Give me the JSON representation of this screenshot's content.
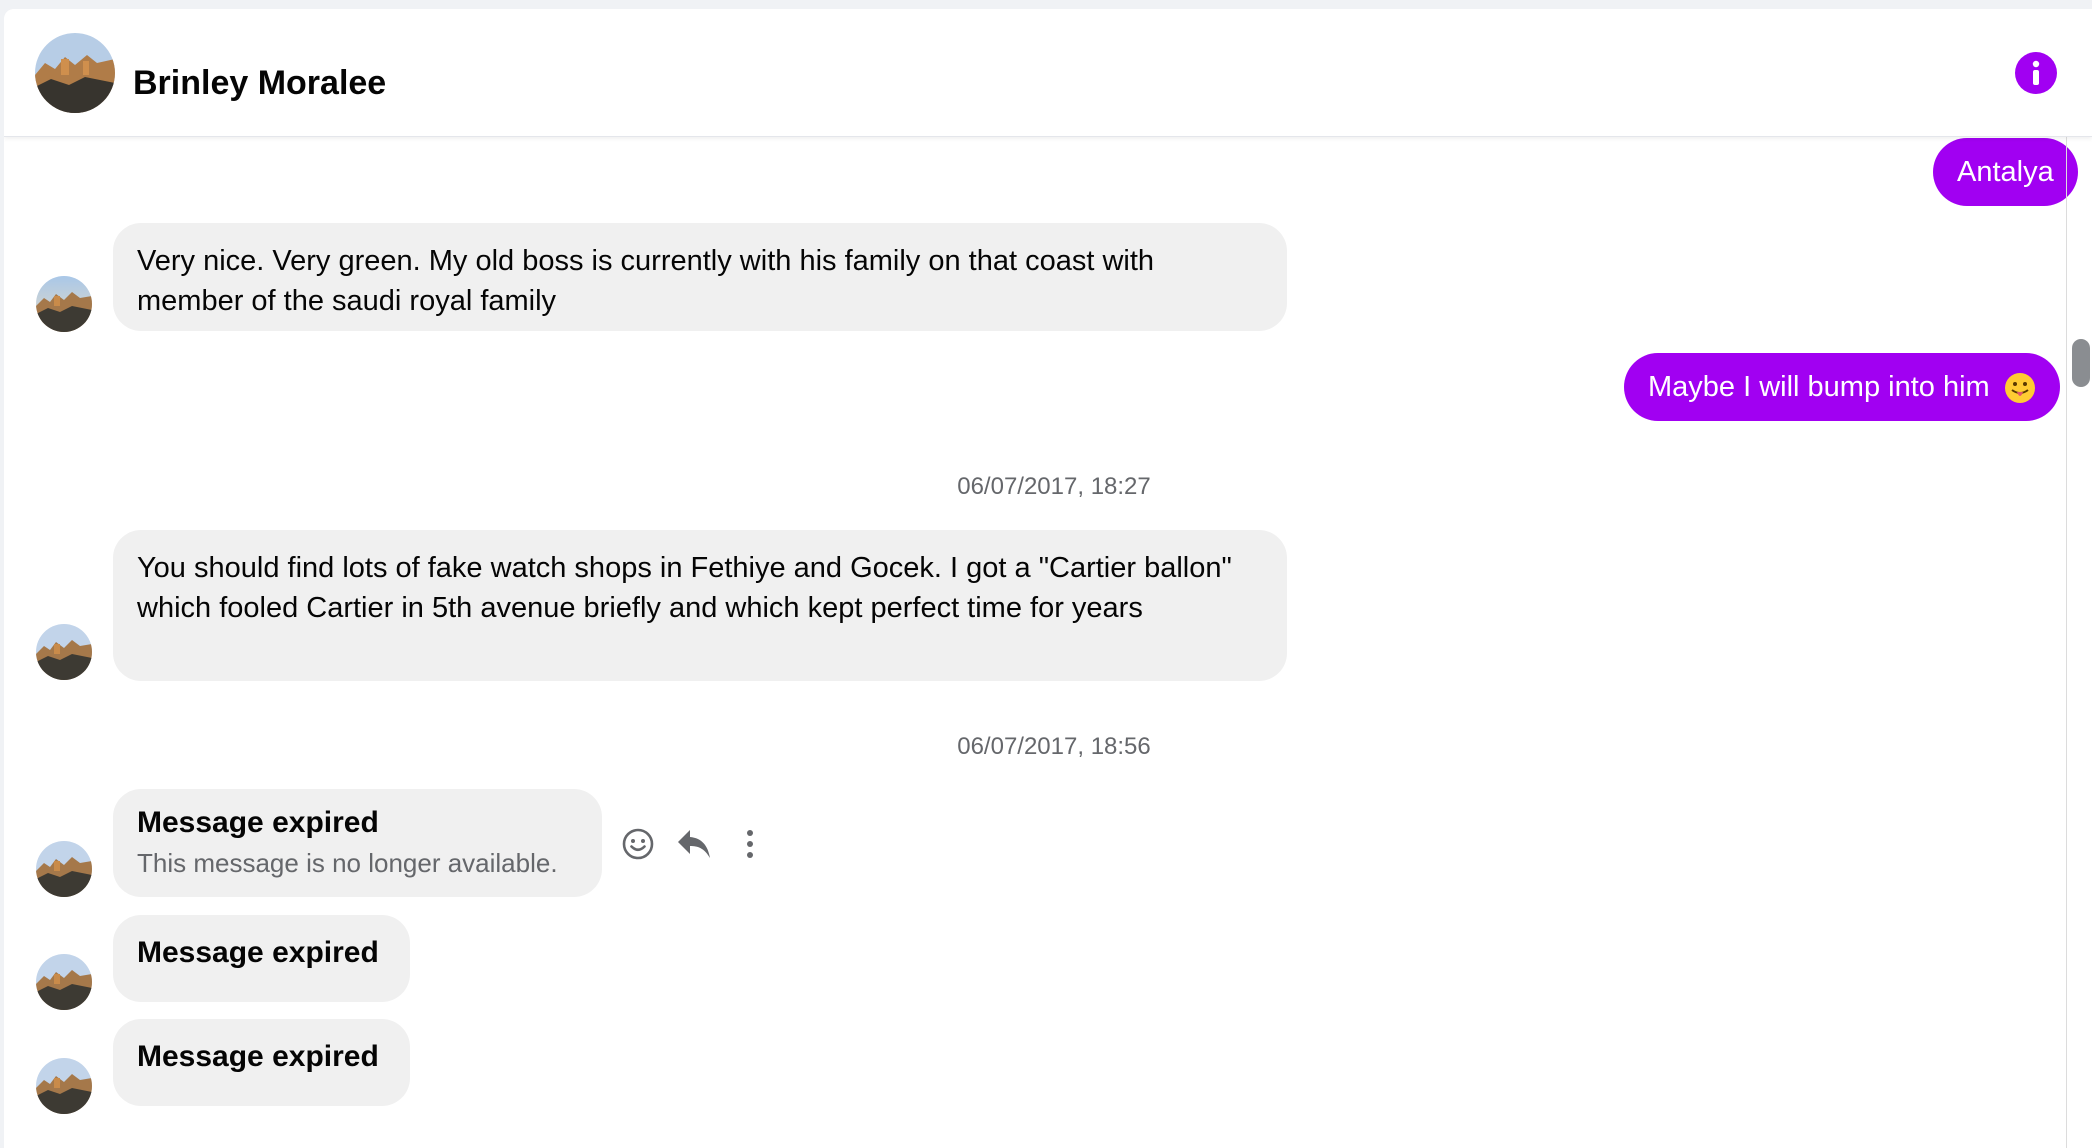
{
  "contact": {
    "name": "Brinley Moralee"
  },
  "colors": {
    "accent": "#a100f2",
    "incoming_bubble": "#f0f0f0",
    "timestamp": "#65676b"
  },
  "icons": {
    "info": "info-circle-icon",
    "react": "smiley-icon",
    "reply": "reply-arrow-icon",
    "more": "vertical-dots-icon"
  },
  "messages": [
    {
      "direction": "out",
      "text": "Antalya"
    },
    {
      "direction": "in",
      "text": "Very nice. Very green.  My old boss is currently with his family on that coast with member of the saudi royal family"
    },
    {
      "direction": "out",
      "text": "Maybe I will bump into him",
      "emoji": "😛"
    },
    {
      "type": "timestamp",
      "text": "06/07/2017, 18:27"
    },
    {
      "direction": "in",
      "text": "You should find lots of fake watch shops in Fethiye and Gocek. I got a \"Cartier ballon\" which fooled Cartier in 5th avenue briefly and which kept perfect time for years"
    },
    {
      "type": "timestamp",
      "text": "06/07/2017, 18:56"
    },
    {
      "direction": "in",
      "expired": true,
      "title": "Message expired",
      "subtitle": "This message is no longer available."
    },
    {
      "direction": "in",
      "expired": true,
      "title": "Message expired"
    },
    {
      "direction": "in",
      "expired": true,
      "title": "Message expired"
    }
  ]
}
